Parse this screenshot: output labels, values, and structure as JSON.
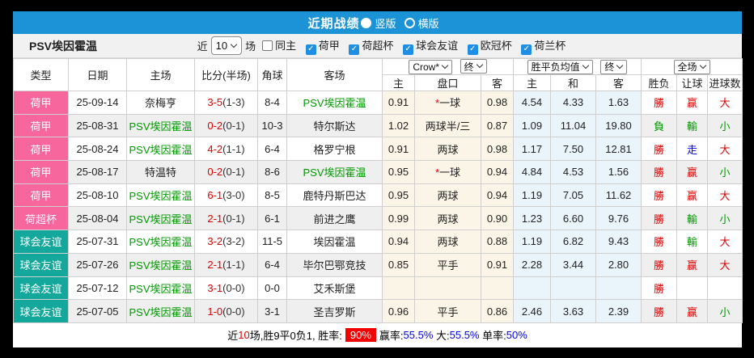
{
  "title_bar": {
    "title": "近期战绩",
    "radio_vertical": "竖版",
    "radio_horizontal": "横版"
  },
  "filter_bar": {
    "team_name": "PSV埃因霍温",
    "near_label": "近",
    "matches_select": "10",
    "matches_label": "场",
    "checkboxes": [
      {
        "label": "同主",
        "checked": false
      },
      {
        "label": "荷甲",
        "checked": true
      },
      {
        "label": "荷超杯",
        "checked": true
      },
      {
        "label": "球会友谊",
        "checked": true
      },
      {
        "label": "欧冠杯",
        "checked": true
      },
      {
        "label": "荷兰杯",
        "checked": true
      }
    ]
  },
  "table": {
    "main_headers": [
      "类型",
      "日期",
      "主场",
      "比分(半场)",
      "角球",
      "客场"
    ],
    "selects": {
      "odds_source": "Crow*",
      "asia_time": "终",
      "europe_type": "胜平负均值",
      "europe_time": "终",
      "scope": "全场"
    },
    "sub_headers": [
      "主",
      "盘口",
      "客",
      "主",
      "和",
      "客",
      "胜负",
      "让球",
      "进球数"
    ],
    "league_styles": {
      "荷甲": "pink",
      "荷超杯": "pink",
      "球会友谊": "teal"
    },
    "result_colors": {
      "勝": "red",
      "負": "green",
      "走": "blue",
      "赢": "red",
      "輸": "green",
      "大": "red",
      "小": "green"
    },
    "rows": [
      {
        "type": "荷甲",
        "date": "25-09-14",
        "home": "奈梅亨",
        "score_ft": "3-5",
        "score_ht": "(1-3)",
        "corner": "8-4",
        "away": "PSV埃因霍温",
        "asia_home": "0.91",
        "handicap_star": "*",
        "handicap": "一球",
        "asia_away": "0.98",
        "eu_home": "4.54",
        "eu_draw": "4.33",
        "eu_away": "1.63",
        "result_wdl": "勝",
        "result_handicap": "赢",
        "result_ou": "大"
      },
      {
        "type": "荷甲",
        "date": "25-08-31",
        "home": "PSV埃因霍温",
        "score_ft": "0-2",
        "score_ht": "(0-1)",
        "corner": "10-3",
        "away": "特尔斯达",
        "asia_home": "1.02",
        "handicap_star": "",
        "handicap": "两球半/三",
        "asia_away": "0.87",
        "eu_home": "1.09",
        "eu_draw": "11.04",
        "eu_away": "19.80",
        "result_wdl": "負",
        "result_handicap": "輸",
        "result_ou": "小"
      },
      {
        "type": "荷甲",
        "date": "25-08-24",
        "home": "PSV埃因霍温",
        "score_ft": "4-2",
        "score_ht": "(1-1)",
        "corner": "6-4",
        "away": "格罗宁根",
        "asia_home": "0.91",
        "handicap_star": "",
        "handicap": "两球",
        "asia_away": "0.98",
        "eu_home": "1.17",
        "eu_draw": "7.50",
        "eu_away": "12.81",
        "result_wdl": "勝",
        "result_handicap": "走",
        "result_ou": "大"
      },
      {
        "type": "荷甲",
        "date": "25-08-17",
        "home": "特温特",
        "score_ft": "0-2",
        "score_ht": "(0-1)",
        "corner": "8-6",
        "away": "PSV埃因霍温",
        "asia_home": "0.95",
        "handicap_star": "*",
        "handicap": "一球",
        "asia_away": "0.94",
        "eu_home": "4.84",
        "eu_draw": "4.53",
        "eu_away": "1.56",
        "result_wdl": "勝",
        "result_handicap": "赢",
        "result_ou": "小"
      },
      {
        "type": "荷甲",
        "date": "25-08-10",
        "home": "PSV埃因霍温",
        "score_ft": "6-1",
        "score_ht": "(3-0)",
        "corner": "8-5",
        "away": "鹿特丹斯巴达",
        "asia_home": "0.95",
        "handicap_star": "",
        "handicap": "两球",
        "asia_away": "0.94",
        "eu_home": "1.19",
        "eu_draw": "7.05",
        "eu_away": "11.62",
        "result_wdl": "勝",
        "result_handicap": "赢",
        "result_ou": "大"
      },
      {
        "type": "荷超杯",
        "date": "25-08-04",
        "home": "PSV埃因霍温",
        "score_ft": "2-1",
        "score_ht": "(0-1)",
        "corner": "6-1",
        "away": "前进之鹰",
        "asia_home": "0.99",
        "handicap_star": "",
        "handicap": "两球",
        "asia_away": "0.90",
        "eu_home": "1.23",
        "eu_draw": "6.60",
        "eu_away": "9.76",
        "result_wdl": "勝",
        "result_handicap": "輸",
        "result_ou": "小"
      },
      {
        "type": "球会友谊",
        "date": "25-07-31",
        "home": "PSV埃因霍温",
        "score_ft": "3-2",
        "score_ht": "(3-2)",
        "corner": "11-5",
        "away": "埃因霍温",
        "asia_home": "0.94",
        "handicap_star": "",
        "handicap": "两球",
        "asia_away": "0.88",
        "eu_home": "1.19",
        "eu_draw": "6.82",
        "eu_away": "9.43",
        "result_wdl": "勝",
        "result_handicap": "輸",
        "result_ou": "大"
      },
      {
        "type": "球会友谊",
        "date": "25-07-26",
        "home": "PSV埃因霍温",
        "score_ft": "2-1",
        "score_ht": "(1-1)",
        "corner": "6-4",
        "away": "毕尔巴鄂竞技",
        "asia_home": "0.85",
        "handicap_star": "",
        "handicap": "平手",
        "asia_away": "0.91",
        "eu_home": "2.28",
        "eu_draw": "3.44",
        "eu_away": "2.80",
        "result_wdl": "勝",
        "result_handicap": "赢",
        "result_ou": "大"
      },
      {
        "type": "球会友谊",
        "date": "25-07-12",
        "home": "PSV埃因霍温",
        "score_ft": "3-1",
        "score_ht": "(0-0)",
        "corner": "0-0",
        "away": "艾禾斯堡",
        "asia_home": "",
        "handicap_star": "",
        "handicap": "",
        "asia_away": "",
        "eu_home": "",
        "eu_draw": "",
        "eu_away": "",
        "result_wdl": "勝",
        "result_handicap": "",
        "result_ou": ""
      },
      {
        "type": "球会友谊",
        "date": "25-07-05",
        "home": "PSV埃因霍温",
        "score_ft": "1-0",
        "score_ht": "(0-0)",
        "corner": "3-1",
        "away": "圣吉罗斯",
        "asia_home": "0.96",
        "handicap_star": "",
        "handicap": "平手",
        "asia_away": "0.86",
        "eu_home": "2.46",
        "eu_draw": "3.63",
        "eu_away": "2.39",
        "result_wdl": "勝",
        "result_handicap": "赢",
        "result_ou": "小"
      }
    ]
  },
  "footer": {
    "segments": [
      {
        "text": "近",
        "style": "plain"
      },
      {
        "text": "10",
        "style": "red"
      },
      {
        "text": "场,胜9平0负1, 胜率:",
        "style": "plain"
      },
      {
        "text": "90%",
        "style": "badge"
      },
      {
        "text": "赢率:",
        "style": "plain"
      },
      {
        "text": "55.5%",
        "style": "blue"
      },
      {
        "text": " 大:",
        "style": "plain"
      },
      {
        "text": "55.5%",
        "style": "blue"
      },
      {
        "text": " 单率:",
        "style": "plain"
      },
      {
        "text": "50%",
        "style": "blue"
      }
    ]
  },
  "colors": {
    "title_bar_blue": "#1C93D6",
    "league_pink": "#F7679E",
    "league_teal": "#14A79B",
    "win_red": "#E00000",
    "loss_green": "#009900",
    "draw_blue": "#0000F0",
    "asia_odds_bg": "#FBF5E7",
    "europe_odds_bg": "#EAF4FB",
    "alt_row_bg": "#EFEFEF",
    "badge_red": "#F50000",
    "checkbox_blue": "#1E8FE4"
  }
}
